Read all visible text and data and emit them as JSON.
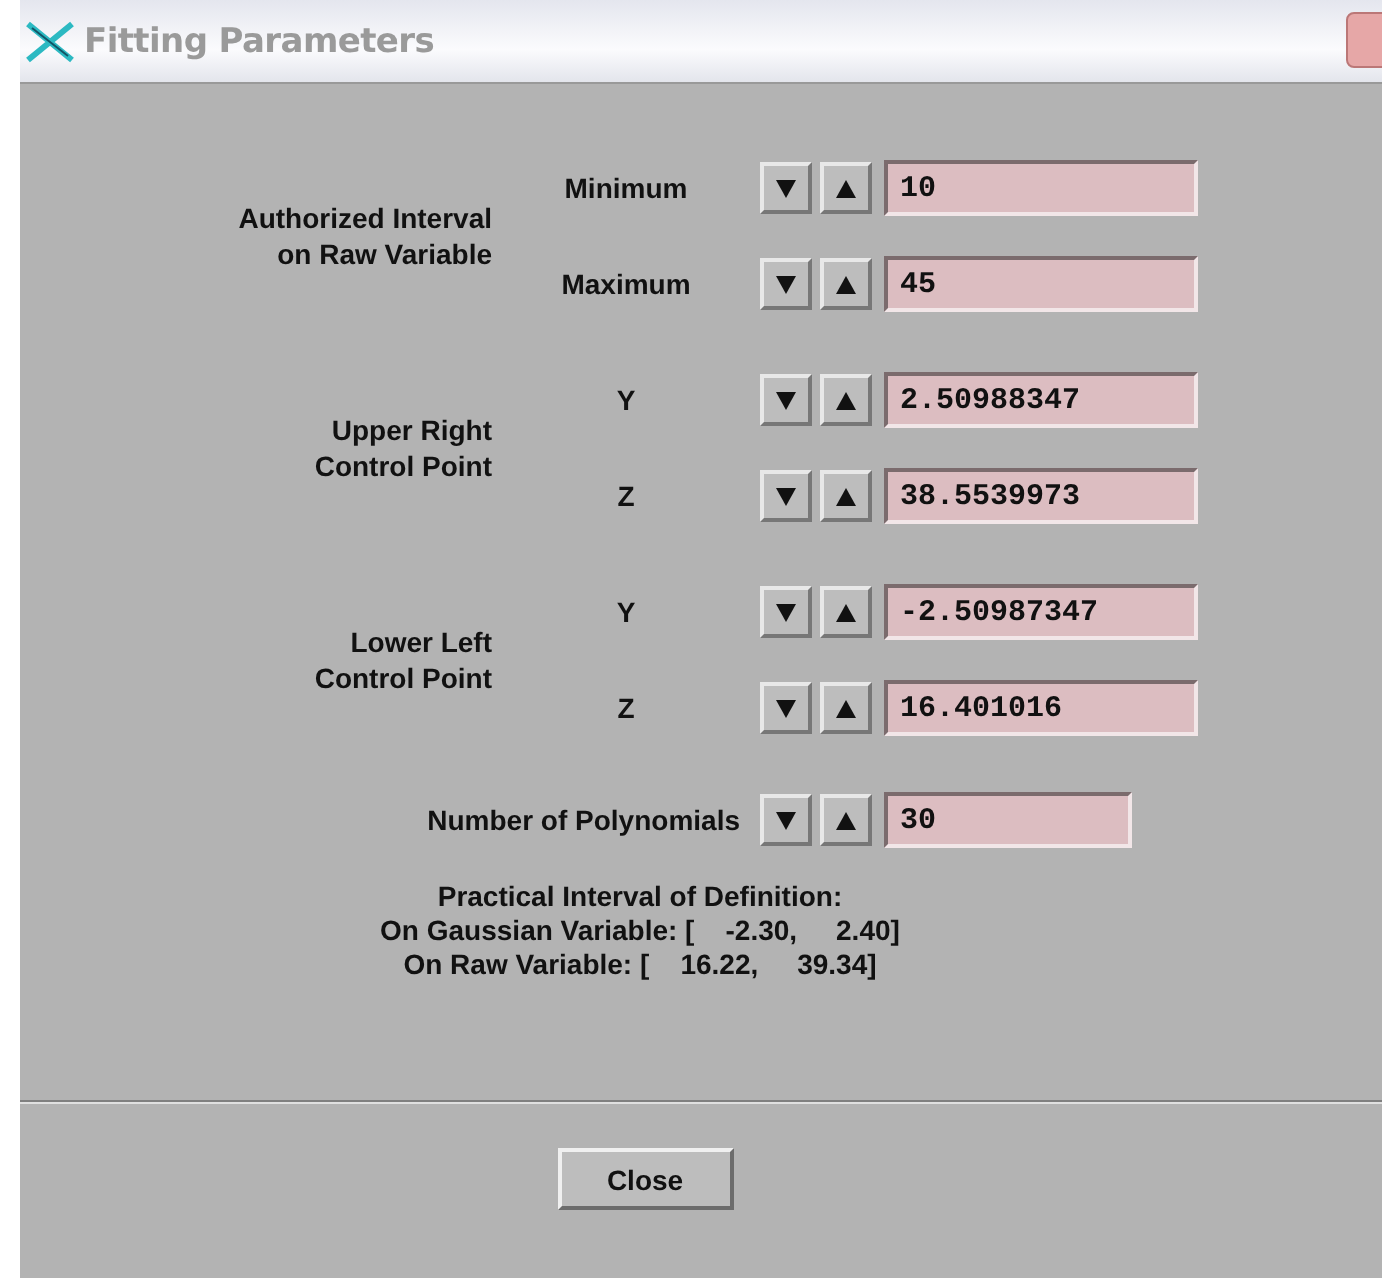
{
  "window": {
    "title": "Fitting Parameters"
  },
  "groups": [
    {
      "label": "Authorized Interval\non Raw Variable",
      "rows": [
        {
          "label": "Minimum",
          "value": "10"
        },
        {
          "label": "Maximum",
          "value": "45"
        }
      ]
    },
    {
      "label": "Upper Right\nControl Point",
      "rows": [
        {
          "label": "Y",
          "value": "2.50988347"
        },
        {
          "label": "Z",
          "value": "38.5539973"
        }
      ]
    },
    {
      "label": "Lower Left\nControl Point",
      "rows": [
        {
          "label": "Y",
          "value": "-2.50987347"
        },
        {
          "label": "Z",
          "value": "16.401016"
        }
      ]
    }
  ],
  "polynomials": {
    "label": "Number of Polynomials",
    "value": "30"
  },
  "info": [
    "Practical Interval of Definition:",
    "On Gaussian Variable: [    -2.30,     2.40]",
    "On Raw Variable: [    16.22,     39.34]"
  ],
  "buttons": [
    "Close"
  ]
}
